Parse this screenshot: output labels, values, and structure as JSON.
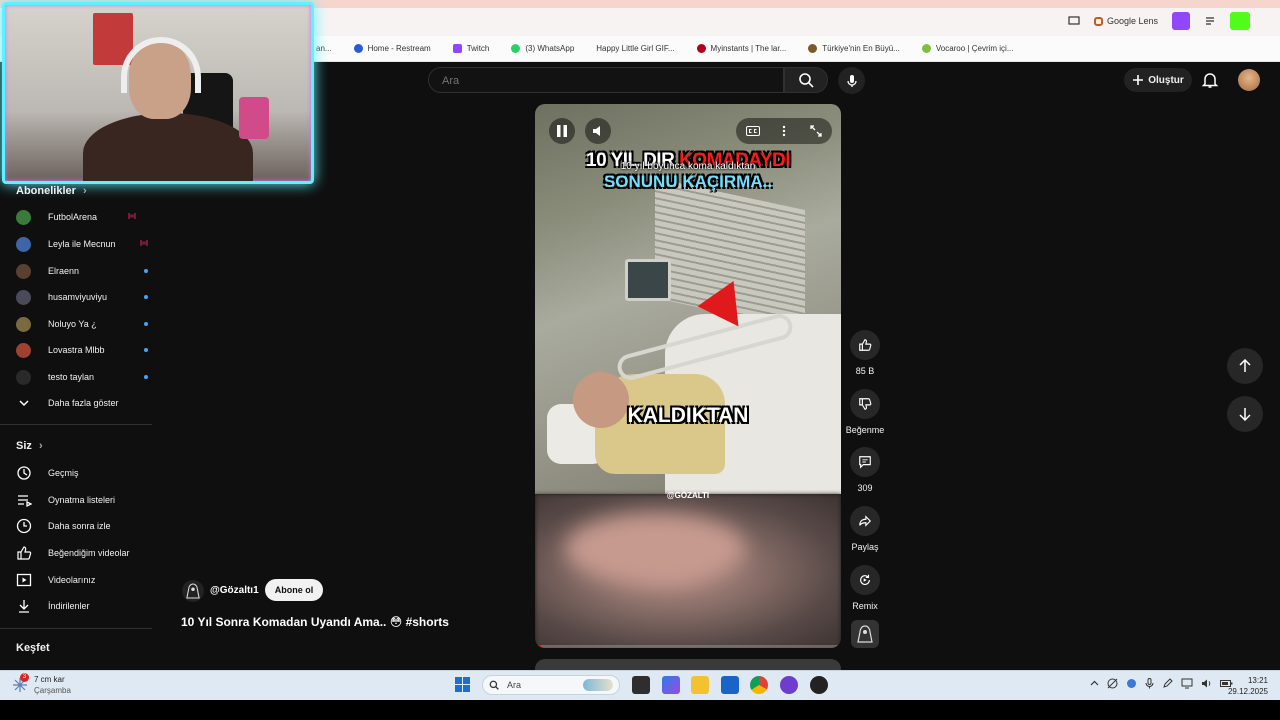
{
  "browser": {
    "bookmarks": [
      {
        "label": "an...",
        "icon": "bookmark-icon",
        "color": "#999999"
      },
      {
        "label": "Home - Restream",
        "icon": "restream-icon",
        "color": "#2a5bd7"
      },
      {
        "label": "Twitch",
        "icon": "twitch-icon",
        "color": "#9146ff"
      },
      {
        "label": "(3) WhatsApp",
        "icon": "whatsapp-icon",
        "color": "#25d366"
      },
      {
        "label": "Happy Little Girl GIF...",
        "icon": "gif-icon",
        "color": "#444444"
      },
      {
        "label": "Myinstants | The lar...",
        "icon": "myinstants-icon",
        "color": "#b3001b"
      },
      {
        "label": "Türkiye'nin En Büyü...",
        "icon": "site-icon",
        "color": "#7a5a2a"
      },
      {
        "label": "Vocaroo | Çevrim içi...",
        "icon": "vocaroo-icon",
        "color": "#7fbf3f"
      }
    ],
    "toolbar_google_label": "Google Lens"
  },
  "youtube": {
    "search_placeholder": "Ara",
    "create_label": "Oluştur"
  },
  "sidebar": {
    "subscriptions_heading": "Abonelikler",
    "subscriptions": [
      {
        "name": "FutbolArena",
        "status": "live",
        "avatar_color": "#3b7a3b"
      },
      {
        "name": "Leyla ile Mecnun",
        "status": "live",
        "avatar_color": "#4064a8"
      },
      {
        "name": "Elraenn",
        "status": "new",
        "avatar_color": "#5a4030"
      },
      {
        "name": "husamviyuviyu",
        "status": "new",
        "avatar_color": "#4a4a5a"
      },
      {
        "name": "Noluyo Ya ¿",
        "status": "new",
        "avatar_color": "#7a6a40"
      },
      {
        "name": "Lovastra Mlbb",
        "status": "new",
        "avatar_color": "#a04030"
      },
      {
        "name": "testo taylan",
        "status": "new",
        "avatar_color": "#2a2a2a"
      }
    ],
    "show_more_label": "Daha fazla göster",
    "you_heading": "Siz",
    "you_items": [
      {
        "label": "Geçmiş",
        "icon": "history-icon"
      },
      {
        "label": "Oynatma listeleri",
        "icon": "playlists-icon"
      },
      {
        "label": "Daha sonra izle",
        "icon": "watch-later-icon"
      },
      {
        "label": "Beğendiğim videolar",
        "icon": "liked-videos-icon"
      },
      {
        "label": "Videolarınız",
        "icon": "your-videos-icon"
      },
      {
        "label": "İndirilenler",
        "icon": "downloads-icon"
      }
    ],
    "explore_heading": "Keşfet"
  },
  "short": {
    "overlay_line1_white": "10 YIL DIR",
    "overlay_line1_red": "KOMADAYDI",
    "overlay_line2": "SONUNU KAÇIRMA..",
    "caption": "10 yıl boyunca koma kaldıktan",
    "big_caption": "KALDIKTAN",
    "watermark": "@GÖZALTI",
    "progress_fraction": 0.02,
    "channel_handle": "@Gözaltı1",
    "subscribe_label": "Abone ol",
    "title": "10 Yıl Sonra Komadan Uyandı Ama.. 😳 #shorts"
  },
  "actions": {
    "like_count": "85 B",
    "dislike_label": "Beğenme",
    "comment_count": "309",
    "share_label": "Paylaş",
    "remix_label": "Remix"
  },
  "taskbar": {
    "weather_temp": "7 cm kar",
    "weather_day": "Çarşamba",
    "weather_badge": "3",
    "search_placeholder": "Ara",
    "time": "13:21",
    "date": "29.12.2025"
  },
  "colors": {
    "accent_red": "#ff0000",
    "webcam_border": "#5cf2ff",
    "live_indicator": "#e0245e",
    "new_indicator": "#3ea6ff"
  }
}
